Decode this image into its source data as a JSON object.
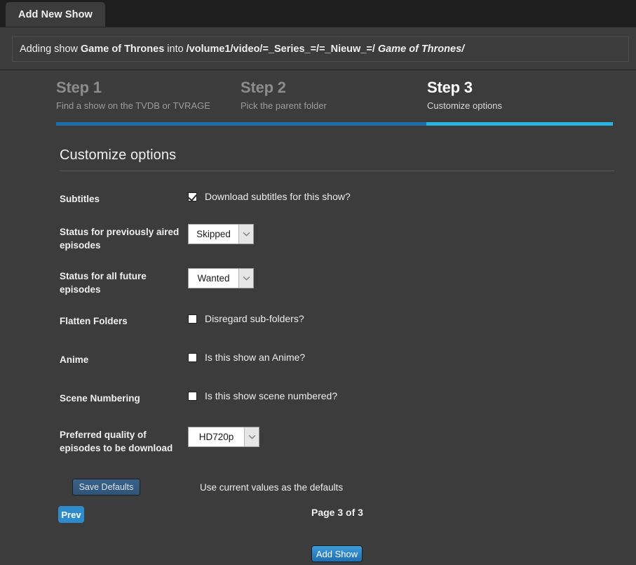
{
  "tab": {
    "label": "Add New Show"
  },
  "notification": {
    "prefix": "Adding show",
    "show_name": "Game of Thrones",
    "middle": "into",
    "parent_path": "/volume1/video/=_Series_=/=_Nieuw_=/",
    "show_folder": "Game of Thrones/"
  },
  "steps": [
    {
      "title": "Step 1",
      "subtitle": "Find a show on the TVDB or TVRAGE",
      "state": "inactive"
    },
    {
      "title": "Step 2",
      "subtitle": "Pick the parent folder",
      "state": "inactive"
    },
    {
      "title": "Step 3",
      "subtitle": "Customize options",
      "state": "active"
    }
  ],
  "progress": {
    "completed_color": "#1a6fa8",
    "active_color": "#29b3e0"
  },
  "section": {
    "heading": "Customize options"
  },
  "form": {
    "subtitles": {
      "label": "Subtitles",
      "checkbox_text": "Download subtitles for this show?",
      "checked": true
    },
    "previously_aired": {
      "label": "Status for previously aired episodes",
      "value": "Skipped"
    },
    "future_episodes": {
      "label": "Status for all future episodes",
      "value": "Wanted"
    },
    "flatten_folders": {
      "label": "Flatten Folders",
      "checkbox_text": "Disregard sub-folders?",
      "checked": false
    },
    "anime": {
      "label": "Anime",
      "checkbox_text": "Is this show an Anime?",
      "checked": false
    },
    "scene_numbering": {
      "label": "Scene Numbering",
      "checkbox_text": "Is this show scene numbered?",
      "checked": false
    },
    "quality": {
      "label": "Preferred quality of episodes to be download",
      "value": "HD720p"
    },
    "save_defaults": {
      "button_label": "Save Defaults",
      "hint": "Use current values as the defaults"
    }
  },
  "footer": {
    "prev_label": "Prev",
    "page_indicator": "Page 3 of 3",
    "add_show_label": "Add Show"
  },
  "theme": {
    "background": "#3c3c3c",
    "tabbar": "#1e1e1e",
    "accent": "#29b3e0",
    "button_blue": "#2e8bcb"
  }
}
